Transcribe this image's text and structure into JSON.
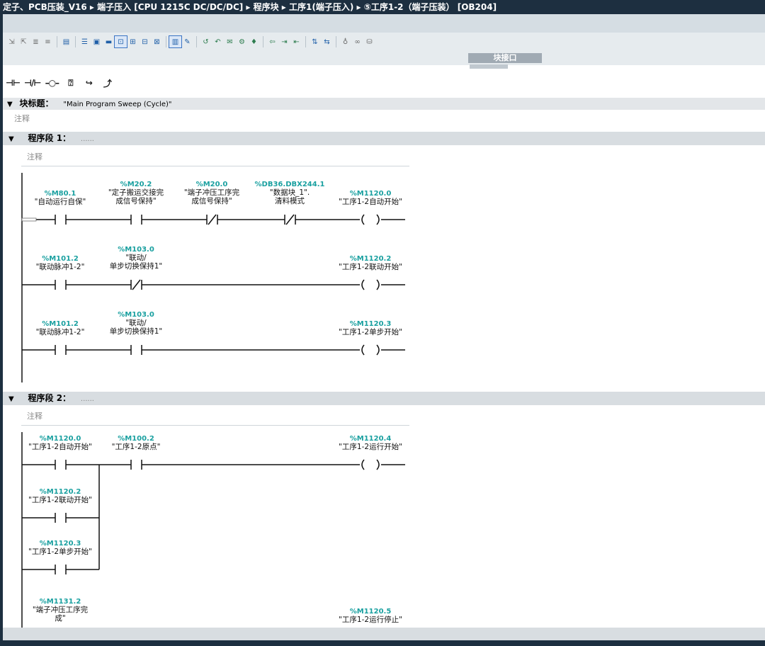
{
  "title": "定子、PCB压装_V16 ▸ 端子压入 [CPU 1215C DC/DC/DC] ▸ 程序块 ▸ 工序1(端子压入) ▸ ⑤工序1-2（端子压装） [OB204]",
  "interface_panel_label": "块接口",
  "block_title": {
    "label": "块标题：",
    "value": "\"Main Program Sweep (Cycle)\"",
    "comment": "注释"
  },
  "segments": [
    {
      "label": "程序段 1：",
      "dots": "......",
      "comment": "注释",
      "rungs": [
        {
          "contacts": [
            {
              "addr": "%M80.1",
              "sym1": "\"自动运行自保\"",
              "sym2": "",
              "sym3": "",
              "type": "NO"
            },
            {
              "addr": "%M20.2",
              "sym1": "\"定子搬运交接完",
              "sym2": "成信号保持\"",
              "sym3": "",
              "type": "NO"
            },
            {
              "addr": "%M20.0",
              "sym1": "\"端子冲压工序完",
              "sym2": "成信号保持\"",
              "sym3": "",
              "type": "NC"
            },
            {
              "addr": "%DB36.DBX244.1",
              "sym1": "\"数据块_1\".",
              "sym2": "清料模式",
              "sym3": "",
              "type": "NC"
            }
          ],
          "coil": {
            "addr": "%M1120.0",
            "sym": "\"工序1-2自动开始\""
          }
        },
        {
          "contacts": [
            {
              "addr": "%M101.2",
              "sym1": "\"联动脉冲1-2\"",
              "sym2": "",
              "sym3": "",
              "type": "NO"
            },
            {
              "addr": "%M103.0",
              "sym1": "\"联动/",
              "sym2": "单步切换保持1\"",
              "sym3": "",
              "type": "NC"
            }
          ],
          "coil": {
            "addr": "%M1120.2",
            "sym": "\"工序1-2联动开始\""
          }
        },
        {
          "contacts": [
            {
              "addr": "%M101.2",
              "sym1": "\"联动脉冲1-2\"",
              "sym2": "",
              "sym3": "",
              "type": "NO"
            },
            {
              "addr": "%M103.0",
              "sym1": "\"联动/",
              "sym2": "单步切换保持1\"",
              "sym3": "",
              "type": "NO"
            }
          ],
          "coil": {
            "addr": "%M1120.3",
            "sym": "\"工序1-2单步开始\""
          }
        }
      ]
    },
    {
      "label": "程序段 2：",
      "dots": "......",
      "comment": "注释",
      "rungs": [
        {
          "parallel": [
            {
              "addr": "%M1120.0",
              "sym1": "\"工序1-2自动开始\""
            },
            {
              "addr": "%M1120.2",
              "sym1": "\"工序1-2联动开始\""
            },
            {
              "addr": "%M1120.3",
              "sym1": "\"工序1-2单步开始\""
            }
          ],
          "series": {
            "addr": "%M100.2",
            "sym1": "\"工序1-2原点\""
          },
          "coil": {
            "addr": "%M1120.4",
            "sym": "\"工序1-2运行开始\""
          }
        },
        {
          "contact": {
            "addr": "%M1131.2",
            "sym1": "\"端子冲压工序完",
            "sym2": "成\""
          },
          "coil": {
            "addr": "%M1120.5",
            "sym": "\"工序1-2运行停止\""
          }
        }
      ]
    }
  ]
}
